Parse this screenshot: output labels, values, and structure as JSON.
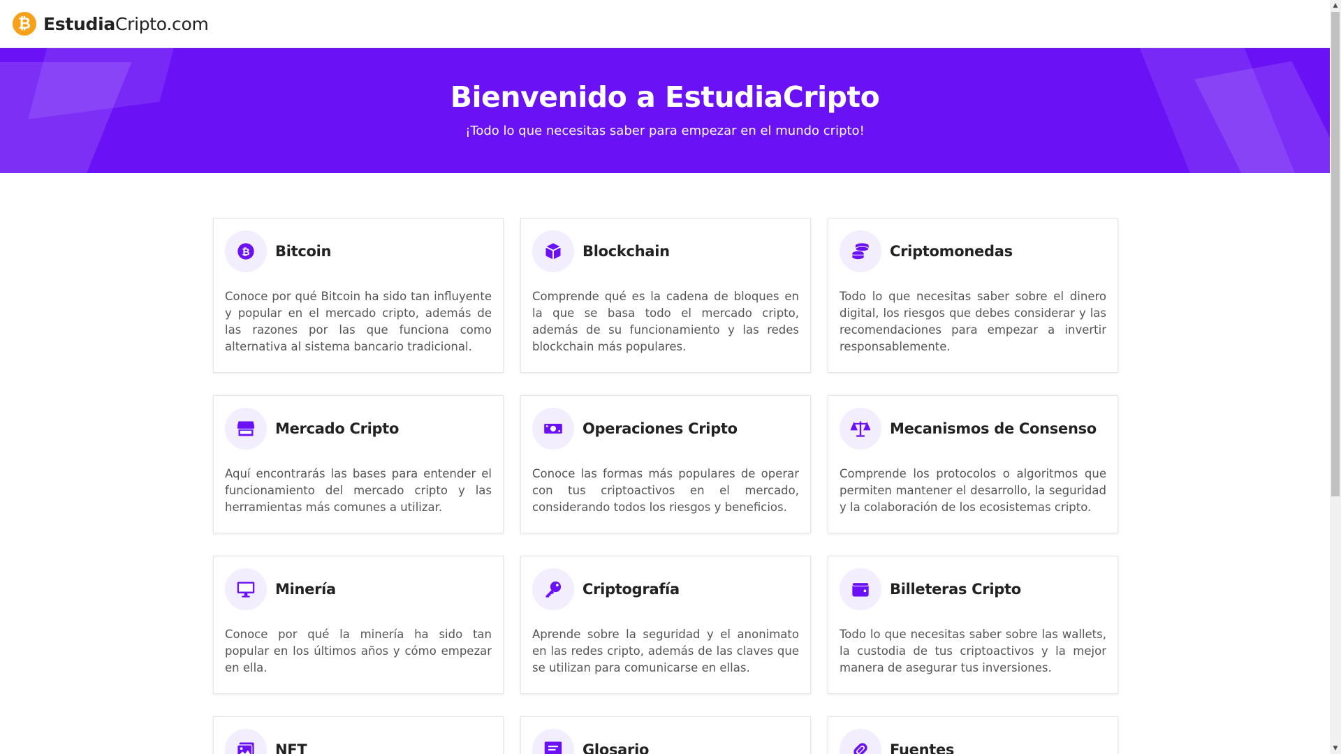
{
  "header": {
    "logo_symbol": "₿",
    "logo_bold": "Estudia",
    "logo_light": "Cripto.com"
  },
  "hero": {
    "title": "Bienvenido a EstudiaCripto",
    "subtitle": "¡Todo lo que necesitas saber para empezar en el mundo cripto!"
  },
  "colors": {
    "brand_purple": "#6a11f5",
    "logo_orange": "#f7a11a",
    "icon_bg": "#f3eefe"
  },
  "cards": [
    {
      "title": "Bitcoin",
      "icon": "bitcoin-icon",
      "text": "Conoce por qué Bitcoin ha sido tan influyente y popular en el mercado cripto, además de las razones por las que funciona como alternativa al sistema bancario tradicional."
    },
    {
      "title": "Blockchain",
      "icon": "cube-icon",
      "text": "Comprende qué es la cadena de bloques en la que se basa todo el mercado cripto, además de su funcionamiento y las redes blockchain más populares."
    },
    {
      "title": "Criptomonedas",
      "icon": "coins-icon",
      "text": "Todo lo que necesitas saber sobre el dinero digital, los riesgos que debes considerar y las recomendaciones para empezar a invertir responsablemente."
    },
    {
      "title": "Mercado Cripto",
      "icon": "store-icon",
      "text": "Aquí encontrarás las bases para entender el funcionamiento del mercado cripto y las herramientas más comunes a utilizar."
    },
    {
      "title": "Operaciones Cripto",
      "icon": "money-bill-icon",
      "text": "Conoce las formas más populares de operar con tus criptoactivos en el mercado, considerando todos los riesgos y beneficios."
    },
    {
      "title": "Mecanismos de Consenso",
      "icon": "scale-icon",
      "text": "Comprende los protocolos o algoritmos que permiten mantener el desarrollo, la seguridad y la colaboración de los ecosistemas cripto."
    },
    {
      "title": "Minería",
      "icon": "desktop-icon",
      "text": "Conoce por qué la minería ha sido tan popular en los últimos años y cómo empezar en ella."
    },
    {
      "title": "Criptografía",
      "icon": "key-icon",
      "text": "Aprende sobre la seguridad y el anonimato en las redes cripto, además de las claves que se utilizan para comunicarse en ellas."
    },
    {
      "title": "Billeteras Cripto",
      "icon": "wallet-icon",
      "text": "Todo lo que necesitas saber sobre las wallets, la custodia de tus criptoactivos y la mejor manera de asegurar tus inversiones."
    },
    {
      "title": "NFT",
      "icon": "image-icon",
      "text": ""
    },
    {
      "title": "Glosario",
      "icon": "message-icon",
      "text": ""
    },
    {
      "title": "Fuentes",
      "icon": "link-icon",
      "text": ""
    }
  ]
}
